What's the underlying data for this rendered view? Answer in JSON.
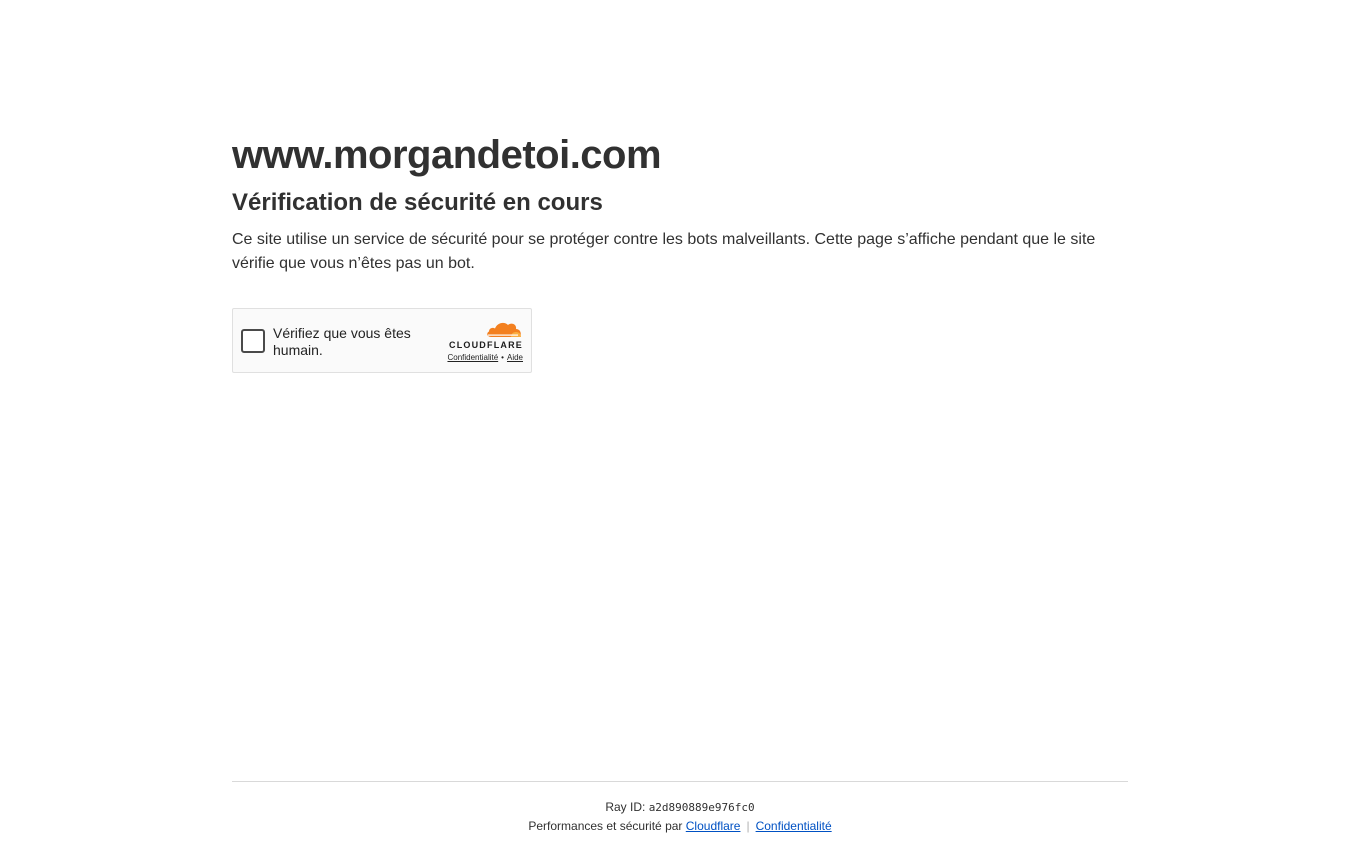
{
  "header": {
    "site_title": "www.morgandetoi.com",
    "subtitle": "Vérification de sécurité en cours",
    "description": "Ce site utilise un service de sécurité pour se protéger contre les bots malveillants. Cette page s’affiche pendant que le site vérifie que vous n’êtes pas un bot."
  },
  "widget": {
    "checkbox_label": "Vérifiez que vous êtes humain.",
    "brand_name": "CLOUDFLARE",
    "privacy_link": "Confidentialité",
    "link_separator": "•",
    "help_link": "Aide",
    "icon": "cloud-icon",
    "brand_color_primary": "#f38020",
    "brand_color_secondary": "#faae40"
  },
  "footer": {
    "ray_label": "Ray ID:",
    "ray_id": "a2d890889e976fc0",
    "perf_text": "Performances et sécurité par",
    "cloudflare_link": "Cloudflare",
    "divider": "|",
    "privacy_link": "Confidentialité",
    "link_color": "#0051c3"
  }
}
